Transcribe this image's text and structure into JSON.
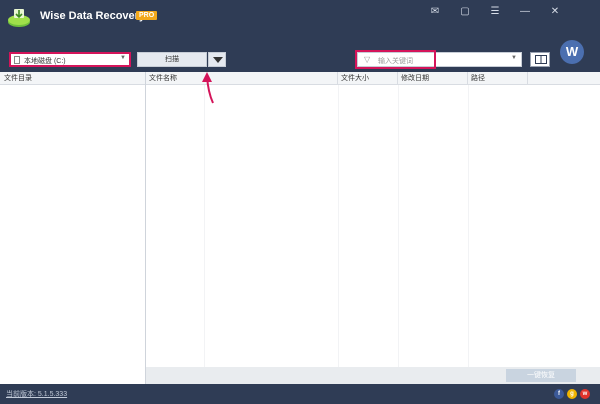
{
  "app": {
    "title": "Wise Data Recovery",
    "badge": "PRO"
  },
  "window_controls": [
    "✉",
    "▢",
    "☰",
    "—",
    "✕"
  ],
  "toolbar": {
    "drive_value": "本地磁盘 (C:)",
    "scan_label": "扫描",
    "search_placeholder": "输入关键词",
    "avatar_letter": "W"
  },
  "left_pane": {
    "header": "文件目录"
  },
  "table": {
    "columns": [
      "文件名称",
      "文件大小",
      "修改日期",
      "路径"
    ]
  },
  "recover_label": "一键恢复",
  "status": {
    "version": "当前版本: 5.1.5.333"
  },
  "colors": {
    "titlebar": "#2f3c55",
    "highlight": "#d4145a",
    "badge": "#f3a91c"
  },
  "icons": [
    "disk-icon",
    "dropdown-arrow-icon",
    "filter-icon",
    "layout-toggle-icon",
    "logo-icon",
    "facebook-icon",
    "google-icon",
    "weibo-icon"
  ]
}
